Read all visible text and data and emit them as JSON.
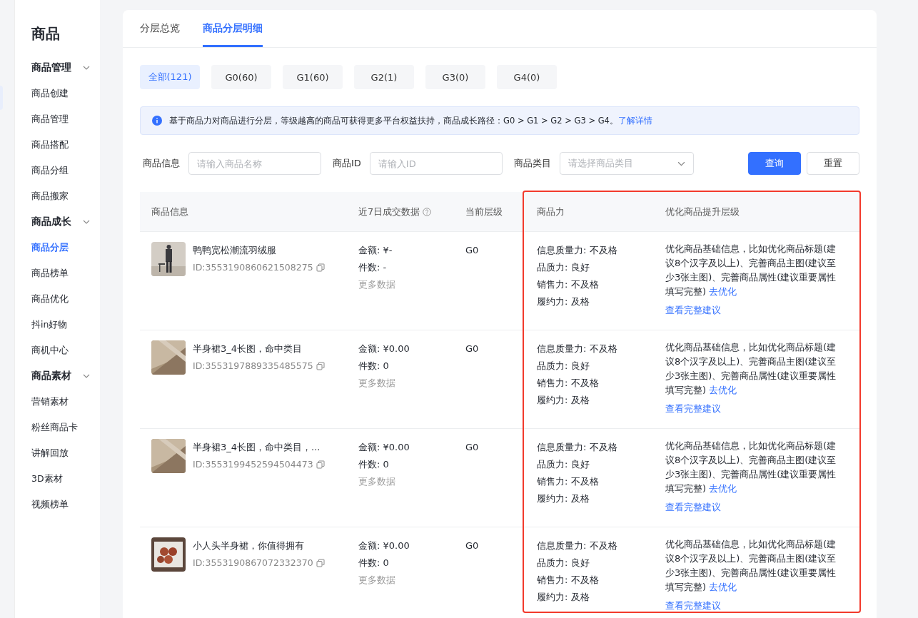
{
  "sidebar": {
    "title": "商品",
    "groups": [
      {
        "label": "商品管理",
        "expanded": true,
        "items": [
          {
            "label": "商品创建",
            "selected": false
          },
          {
            "label": "商品管理",
            "selected": false
          },
          {
            "label": "商品搭配",
            "selected": false
          },
          {
            "label": "商品分组",
            "selected": false
          },
          {
            "label": "商品搬家",
            "selected": false
          }
        ]
      },
      {
        "label": "商品成长",
        "expanded": true,
        "items": [
          {
            "label": "商品分层",
            "selected": true
          },
          {
            "label": "商品榜单",
            "selected": false
          },
          {
            "label": "商品优化",
            "selected": false
          },
          {
            "label": "抖in好物",
            "selected": false
          },
          {
            "label": "商机中心",
            "selected": false
          }
        ]
      },
      {
        "label": "商品素材",
        "expanded": true,
        "items": [
          {
            "label": "营销素材",
            "selected": false
          },
          {
            "label": "粉丝商品卡",
            "selected": false
          },
          {
            "label": "讲解回放",
            "selected": false
          },
          {
            "label": "3D素材",
            "selected": false
          },
          {
            "label": "视频榜单",
            "selected": false
          }
        ]
      }
    ]
  },
  "tabs": [
    {
      "label": "分层总览",
      "selected": false
    },
    {
      "label": "商品分层明细",
      "selected": true
    }
  ],
  "filters": [
    {
      "label": "全部(121)",
      "selected": true
    },
    {
      "label": "G0(60)",
      "selected": false
    },
    {
      "label": "G1(60)",
      "selected": false
    },
    {
      "label": "G2(1)",
      "selected": false
    },
    {
      "label": "G3(0)",
      "selected": false
    },
    {
      "label": "G4(0)",
      "selected": false
    }
  ],
  "notice": {
    "text": "基于商品力对商品进行分层，等级越高的商品可获得更多平台权益扶持，商品成长路径：G0 > G1 > G2 > G3 > G4。",
    "link": "了解详情"
  },
  "search": {
    "fields": [
      {
        "label": "商品信息",
        "kind": "text",
        "placeholder": "请输入商品名称"
      },
      {
        "label": "商品ID",
        "kind": "text",
        "placeholder": "请输入ID"
      },
      {
        "label": "商品类目",
        "kind": "select",
        "placeholder": "请选择商品类目"
      }
    ],
    "buttons": [
      {
        "label": "查询",
        "kind": "primary"
      },
      {
        "label": "重置",
        "kind": "default"
      }
    ]
  },
  "table": {
    "highlight_frame": true,
    "columns": [
      {
        "label": "商品信息",
        "help": false
      },
      {
        "label": "近7日成交数据",
        "help": true
      },
      {
        "label": "当前层级",
        "help": false
      },
      {
        "label": "商品力",
        "help": false
      },
      {
        "label": "优化商品提升层级",
        "help": false
      }
    ],
    "rows": [
      {
        "image": {
          "kind": "picture"
        },
        "name": "鸭鸭宽松潮流羽绒服",
        "id": "ID:3553190860621508275",
        "amount": "金额: ¥-",
        "count": "件数: -",
        "more": "更多数据",
        "level": "G0",
        "powers": [
          "信息质量力: 不及格",
          "品质力: 良好",
          "销售力: 不及格",
          "履约力: 及格"
        ],
        "suggestion": "优化商品基础信息，比如优化商品标题(建议8个汉字及以上)、完善商品主图(建议至少3张主图)、完善商品属性(建议重要属性填写完整)",
        "optimize": "去优化",
        "view_all": "查看完整建议"
      },
      {
        "image": {
          "kind": "picture"
        },
        "name": "半身裙3_4长图，命中类目",
        "id": "ID:3553197889335485575",
        "amount": "金额: ¥0.00",
        "count": "件数: 0",
        "more": "更多数据",
        "level": "G0",
        "powers": [
          "信息质量力: 不及格",
          "品质力: 良好",
          "销售力: 不及格",
          "履约力: 及格"
        ],
        "suggestion": "优化商品基础信息，比如优化商品标题(建议8个汉字及以上)、完善商品主图(建议至少3张主图)、完善商品属性(建议重要属性填写完整)",
        "optimize": "去优化",
        "view_all": "查看完整建议"
      },
      {
        "image": {
          "kind": "picture"
        },
        "name": "半身裙3_4长图，命中类目，...",
        "id": "ID:3553199452594504473",
        "amount": "金额: ¥0.00",
        "count": "件数: 0",
        "more": "更多数据",
        "level": "G0",
        "powers": [
          "信息质量力: 不及格",
          "品质力: 良好",
          "销售力: 不及格",
          "履约力: 及格"
        ],
        "suggestion": "优化商品基础信息，比如优化商品标题(建议8个汉字及以上)、完善商品主图(建议至少3张主图)、完善商品属性(建议重要属性填写完整)",
        "optimize": "去优化",
        "view_all": "查看完整建议"
      },
      {
        "image": {
          "kind": "picture"
        },
        "name": "小人头半身裙，你值得拥有",
        "id": "ID:3553190867072332370",
        "amount": "金额: ¥0.00",
        "count": "件数: 0",
        "more": "更多数据",
        "level": "G0",
        "powers": [
          "信息质量力: 不及格",
          "品质力: 良好",
          "销售力: 不及格",
          "履约力: 及格"
        ],
        "suggestion": "优化商品基础信息，比如优化商品标题(建议8个汉字及以上)、完善商品主图(建议至少3张主图)、完善商品属性(建议重要属性填写完整)",
        "optimize": "去优化",
        "view_all": "查看完整建议"
      }
    ]
  }
}
